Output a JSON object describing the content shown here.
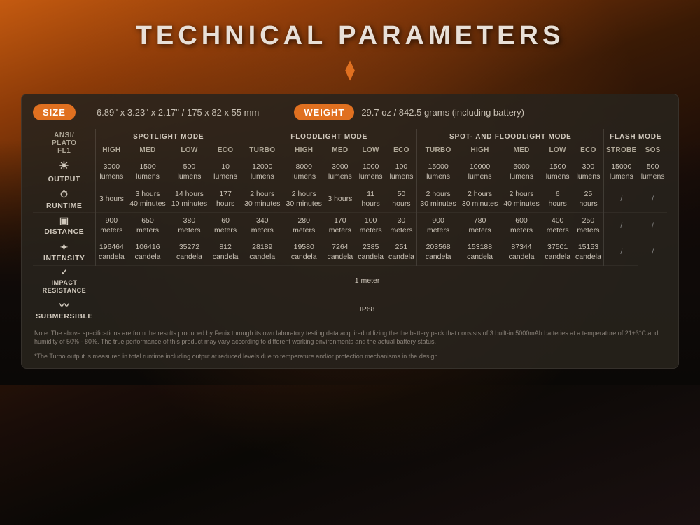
{
  "title": "TECHNICAL PARAMETERS",
  "chevron": "⌄",
  "size": {
    "label": "SIZE",
    "value": "6.89'' x 3.23'' x 2.17'' / 175 x 82 x 55 mm"
  },
  "weight": {
    "label": "WEIGHT",
    "value": "29.7 oz / 842.5 grams (including battery)"
  },
  "modes": {
    "spotlight": "SPOTLIGHT MODE",
    "floodlight": "FLOODLIGHT MODE",
    "spot_flood": "SPOT- AND FLOODLIGHT MODE",
    "flash": "FLASH MODE"
  },
  "subheaders": [
    "HIGH",
    "MED",
    "LOW",
    "ECO",
    "TURBO",
    "HIGH",
    "MED",
    "LOW",
    "ECO",
    "TURBO",
    "HIGH",
    "MED",
    "LOW",
    "ECO",
    "STROBE",
    "SOS"
  ],
  "rows": {
    "output": {
      "icon": "☀",
      "label": "OUTPUT",
      "data": [
        "3000 lumens",
        "1500 lumens",
        "500 lumens",
        "10 lumens",
        "12000 lumens",
        "8000 lumens",
        "3000 lumens",
        "1000 lumens",
        "100 lumens",
        "15000 lumens",
        "10000 lumens",
        "5000 lumens",
        "1500 lumens",
        "300 lumens",
        "15000 lumens",
        "500 lumens"
      ]
    },
    "runtime": {
      "icon": "⏱",
      "label": "RUNTIME",
      "data": [
        "3 hours",
        "3 hours 40 minutes",
        "14 hours 10 minutes",
        "177 hours",
        "2 hours 30 minutes",
        "2 hours 30 minutes",
        "3 hours",
        "11 hours",
        "50 hours",
        "2 hours 30 minutes",
        "2 hours 30 minutes",
        "2 hours 40 minutes",
        "6 hours",
        "25 hours",
        "/",
        "/"
      ]
    },
    "distance": {
      "icon": "◎",
      "label": "DISTANCE",
      "data": [
        "900 meters",
        "650 meters",
        "380 meters",
        "60 meters",
        "340 meters",
        "280 meters",
        "170 meters",
        "100 meters",
        "30 meters",
        "900 meters",
        "780 meters",
        "600 meters",
        "400 meters",
        "250 meters",
        "/",
        "/"
      ]
    },
    "intensity": {
      "icon": "+",
      "label": "INTENSITY",
      "data": [
        "196464 candela",
        "106416 candela",
        "35272 candela",
        "812 candela",
        "28189 candela",
        "19580 candela",
        "7264 candela",
        "2385 candela",
        "251 candela",
        "203568 candela",
        "153188 candela",
        "87344 candela",
        "37501 candela",
        "15153 candela",
        "/",
        "/"
      ]
    },
    "impact": {
      "icon": "✓",
      "label": "IMPACT RESISTANCE",
      "value": "1 meter"
    },
    "submersible": {
      "icon": "~",
      "label": "SUBMERSIBLE",
      "value": "IP68"
    }
  },
  "ansi_label": "ANSI/ PLATO FL1",
  "notes": [
    "Note: The above specifications are from the results produced by Fenix through its own laboratory testing data acquired utilizing the the battery pack that consists of 3 built-in 5000mAh batteries at a temperature of 21±3°C and humidity of 50% - 80%.  The true performance of this product may vary according to different working environments and the actual battery status.",
    "*The Turbo output is measured in total runtime including output at reduced levels due to temperature and/or protection mechanisms in the design."
  ]
}
